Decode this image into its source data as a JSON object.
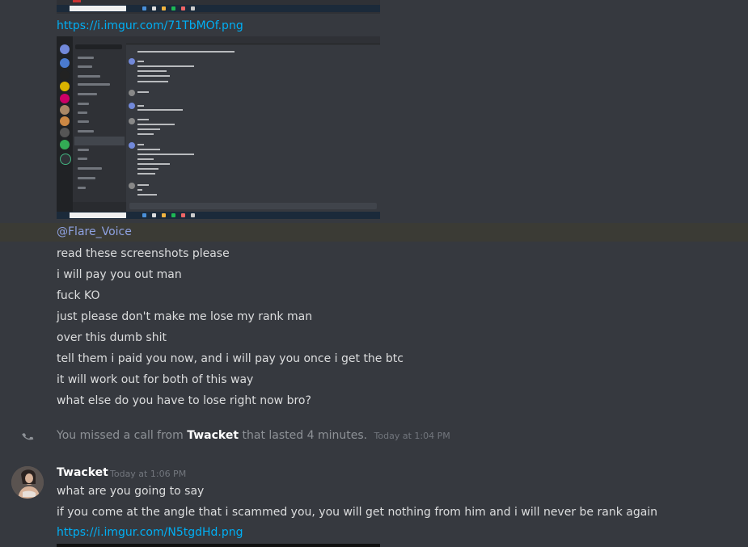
{
  "messages": {
    "link1": "https://i.imgur.com/71TbMOf.png",
    "mention": "@Flare_Voice",
    "lines": [
      "read these screenshots please",
      "i will pay you out man",
      "fuck KO",
      "just please don't make me lose my rank man",
      "over this dumb shit",
      "tell them i paid you now, and i will pay you once i get the btc",
      "it will work out for both of this way",
      "what else do you have to lose right now bro?"
    ]
  },
  "call": {
    "prefix": "You missed a call from",
    "caller": "Twacket",
    "suffix": "that lasted 4 minutes.",
    "timestamp": "Today at 1:04 PM",
    "icon": "phone-missed-icon"
  },
  "twacket_message": {
    "author": "Twacket",
    "timestamp": "Today at 1:06 PM",
    "lines": [
      "what are you going to say",
      "if you come at the angle that i scammed you, you will get nothing from him and i will never be rank again"
    ],
    "link": "https://i.imgur.com/N5tgdHd.png"
  },
  "colors": {
    "background": "#36393f",
    "link": "#00aff4",
    "mention": "#8ea1e1",
    "highlight": "#3b3b35"
  }
}
